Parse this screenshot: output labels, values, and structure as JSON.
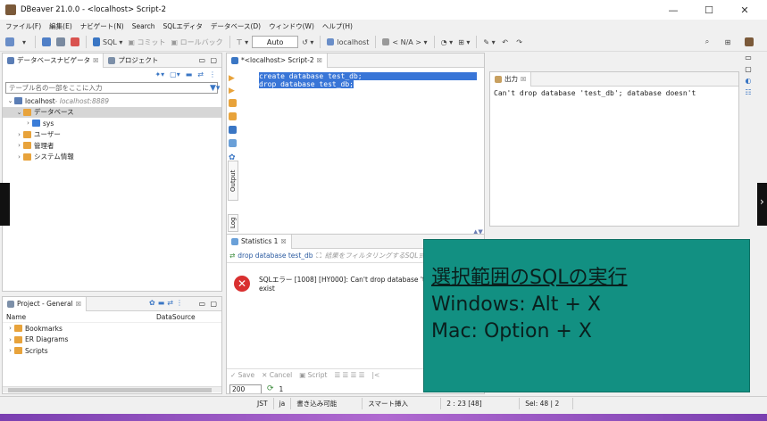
{
  "window": {
    "title": "DBeaver 21.0.0 - <localhost> Script-2",
    "controls": {
      "minimize": "—",
      "maximize": "☐",
      "close": "✕"
    }
  },
  "menu": [
    "ファイル(F)",
    "編集(E)",
    "ナビゲート(N)",
    "Search",
    "SQLエディタ",
    "データベース(D)",
    "ウィンドウ(W)",
    "ヘルプ(H)"
  ],
  "toolbar": {
    "sql_label": "SQL",
    "commit_label": "コミット",
    "rollback_label": "ロールバック",
    "auto_label": "Auto",
    "connection_label": "localhost",
    "schema_label": "< N/A >"
  },
  "navigator": {
    "tab_label": "データベースナビゲータ",
    "tab_close": "☒",
    "project_tab_label": "プロジェクト",
    "filter_placeholder": "テーブル名の一部をここに入力",
    "tree": [
      {
        "label": "localhost",
        "note": " - localhost:8889",
        "level": 0,
        "arrow": "⌄",
        "color": "#5a7db5",
        "selected": false
      },
      {
        "label": "データベース",
        "note": "",
        "level": 1,
        "arrow": "⌄",
        "color": "#e8a33b",
        "selected": true
      },
      {
        "label": "sys",
        "note": "",
        "level": 2,
        "arrow": "›",
        "color": "#3b7dd8",
        "selected": false
      },
      {
        "label": "ユーザー",
        "note": "",
        "level": 1,
        "arrow": "›",
        "color": "#e8a33b",
        "selected": false
      },
      {
        "label": "管理者",
        "note": "",
        "level": 1,
        "arrow": "›",
        "color": "#e8a33b",
        "selected": false
      },
      {
        "label": "システム情報",
        "note": "",
        "level": 1,
        "arrow": "›",
        "color": "#e8a33b",
        "selected": false
      }
    ]
  },
  "project_panel": {
    "tab_label": "Project - General",
    "tab_close": "☒",
    "columns": [
      "Name",
      "DataSource"
    ],
    "items": [
      "Bookmarks",
      "ER Diagrams",
      "Scripts"
    ]
  },
  "editor": {
    "tab_label": "*<localhost> Script-2",
    "tab_close": "☒",
    "lines": [
      "create database test_db;",
      "drop database test_db;"
    ],
    "side_tabs": [
      "Output",
      "Log"
    ]
  },
  "output_panel": {
    "tab_label": "出力",
    "tab_close": "☒",
    "text": "Can't drop database 'test_db'; database doesn't"
  },
  "statistics": {
    "tab_label": "Statistics 1",
    "tab_close": "☒",
    "query_tab": "drop database test_db",
    "filter_placeholder": "結果をフィルタリングするSQL式",
    "error_text": "SQLエラー [1008] [HY000]: Can't drop database 'test_db'; database doesn't exist",
    "error_text_line1": "SQLエラー [1008] [HY000]: Can't drop database 'test",
    "error_text_line2": "exist",
    "bottom_buttons": [
      "Save",
      "Cancel",
      "Script"
    ],
    "page_size": "200",
    "row_count": "1"
  },
  "overlay": {
    "line1": "選択範囲のSQLの実行",
    "line2": "Windows: Alt + X",
    "line3": "Mac: Option + X"
  },
  "statusbar": {
    "timezone": "JST",
    "locale": "ja",
    "mode": "書き込み可能",
    "insert": "スマート挿入",
    "position": "2 : 23 [48]",
    "selection": "Sel: 48 | 2"
  },
  "colors": {
    "overlay_bg": "#129082",
    "selection": "#3875d7",
    "error_icon": "#d93030"
  }
}
